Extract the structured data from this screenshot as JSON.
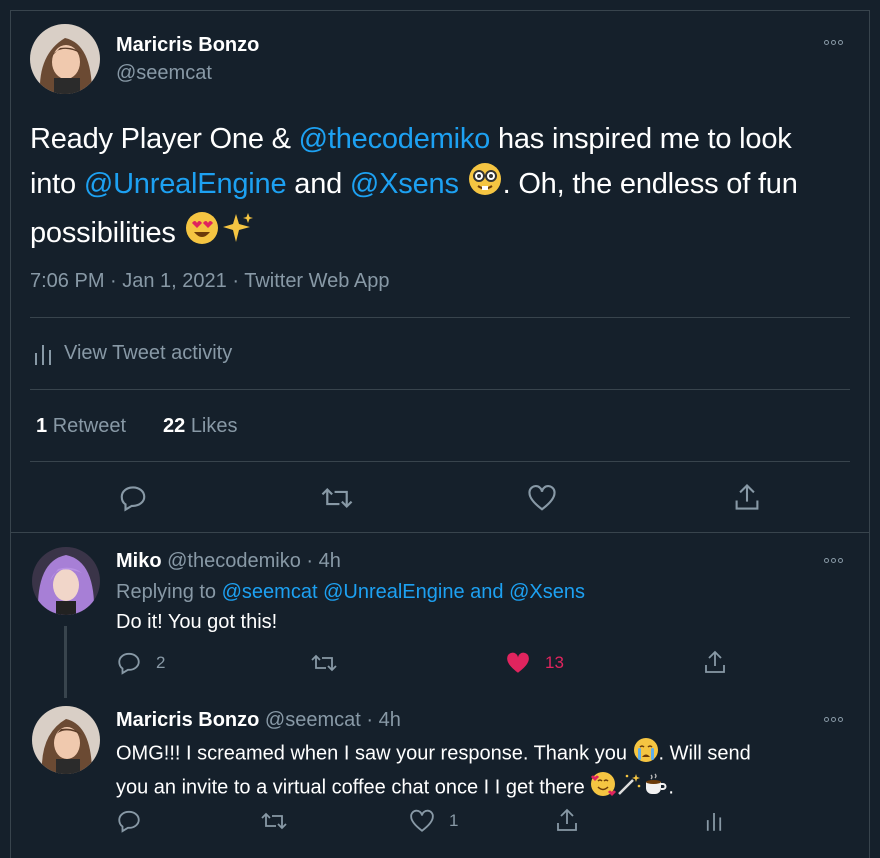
{
  "tweet": {
    "author_name": "Maricris Bonzo",
    "author_handle": "@seemcat",
    "text_parts": {
      "p1": "Ready Player One & ",
      "mention1": "@thecodemiko",
      "p2": " has inspired me to look into ",
      "mention2": "@UnrealEngine",
      "p3": " and ",
      "mention3": "@Xsens",
      "p4": ". Oh, the endless of fun possibilities "
    },
    "emoji": [
      "nerd-face",
      "heart-eyes",
      "sparkles"
    ],
    "meta": "7:06 PM · Jan 1, 2021 · Twitter Web App",
    "activity_label": "View Tweet activity",
    "retweets_count": "1",
    "retweets_label": "Retweet",
    "likes_count": "22",
    "likes_label": "Likes"
  },
  "replies": [
    {
      "author_name": "Miko",
      "author_handle": "@thecodemiko",
      "time": "· 4h",
      "replying_prefix": "Replying to ",
      "replying_targets": [
        "@seemcat",
        "@UnrealEngine",
        "and",
        "@Xsens"
      ],
      "text": "Do it! You got this!",
      "reply_count": "2",
      "like_count": "13"
    },
    {
      "author_name": "Maricris Bonzo",
      "author_handle": "@seemcat",
      "time": "· 4h",
      "text_line1": "OMG!!! I screamed when I saw your response. Thank you ",
      "text_line1b": ". Will send",
      "text_line2": "you an invite to a virtual coffee chat once I I get there ",
      "text_line2b": ".",
      "like_count": "1"
    }
  ],
  "colors": {
    "background": "#15202b",
    "link": "#1da1f2",
    "muted": "#8899a6",
    "like": "#e0245e",
    "divider": "#38444d"
  }
}
